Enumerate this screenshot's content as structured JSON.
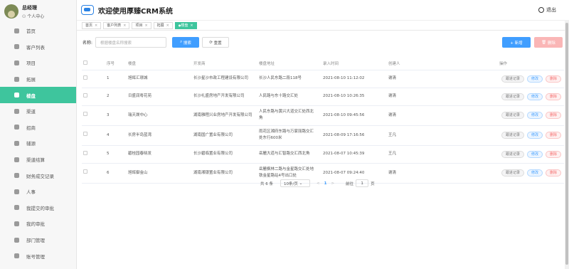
{
  "profile": {
    "name": "总经理",
    "sub": "个人中心"
  },
  "nav": [
    "首页",
    "客户列表",
    "项目",
    "拓展",
    "楼盘",
    "渠道",
    "招商",
    "辅源",
    "渠道结算",
    "财务成交记录",
    "人事",
    "我提交的审批",
    "我的审批",
    "部门管理",
    "账号管理"
  ],
  "nav_active": 4,
  "header": {
    "title": "欢迎使用厚臻CRM系统",
    "logout": "退出"
  },
  "tabs": [
    {
      "label": "首页"
    },
    {
      "label": "客户列表"
    },
    {
      "label": "项目"
    },
    {
      "label": "拓展"
    },
    {
      "label": "楼盘"
    }
  ],
  "search": {
    "label": "名称:",
    "placeholder": "根据楼盘名称搜索",
    "search_btn": "搜索",
    "reset_btn": "重置",
    "add_btn": "+ 新增",
    "delete_btn": "删除"
  },
  "table": {
    "headers": [
      "序号",
      "楼盘",
      "开发商",
      "楼盘地址",
      "录入时间",
      "创建人",
      "操作"
    ],
    "rows": [
      {
        "no": "1",
        "name": "旭辉汇璟城",
        "dev": "长沙星沙市政工程建设有限公司",
        "addr": "长沙人民东路二段118号",
        "time": "2021-08-10 11:12:02",
        "creator": "谢清"
      },
      {
        "no": "2",
        "name": "日盛润粤花苑",
        "dev": "长沙礼盛房地产开发有限公司",
        "addr": "人民路与东十路交汇处",
        "time": "2021-08-10 10:26:35",
        "creator": "谢清"
      },
      {
        "no": "3",
        "name": "瑞天晟中心",
        "dev": "湖南雅程兴业房地产开发有限公司",
        "addr": "人民东路与黄兴大道交汇处西北角",
        "time": "2021-08-10 09:45:56",
        "creator": "谢清"
      },
      {
        "no": "4",
        "name": "长房半岛蓝湾",
        "dev": "湖南国广置业有限公司",
        "addr": "雨花区湘府东路与万家丽路交汇处东行600米",
        "time": "2021-08-09 17:16:56",
        "creator": "王凡"
      },
      {
        "no": "5",
        "name": "碧桂园春晓发",
        "dev": "长沙碧临置业有限公司",
        "addr": "岳麓大道与汇智路交汇西北角",
        "time": "2021-08-07 10:45:39",
        "creator": "王凡"
      },
      {
        "no": "6",
        "name": "旭辉御金山",
        "dev": "湖南湘银置业有限公司",
        "addr": "岳麓枫林二路与金星路交汇处地铁金星路站4号出口处",
        "time": "2021-08-07 09:24:40",
        "creator": "谢清"
      }
    ],
    "ops": [
      "跟进记录",
      "修改",
      "删除"
    ]
  },
  "pager": {
    "total": "共 6 条",
    "size": "10条/页",
    "prev": "<",
    "page": "1",
    "next": ">",
    "goto": "前往",
    "goto_val": "1",
    "unit": "页"
  }
}
